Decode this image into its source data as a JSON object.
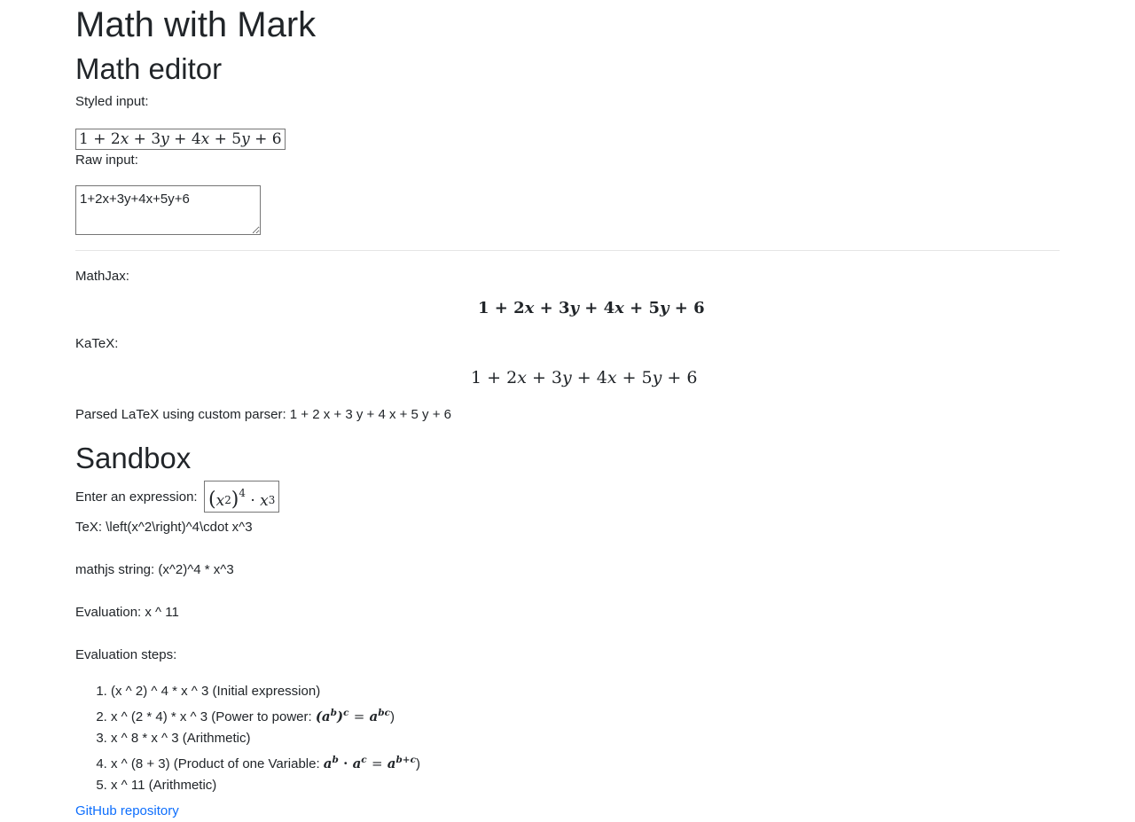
{
  "page": {
    "title": "Math with Mark"
  },
  "editor": {
    "heading": "Math editor",
    "styled_label": "Styled input:",
    "raw_label": "Raw input:",
    "raw_value": "1+2x+3y+4x+5y+6",
    "mathjax_label": "MathJax:",
    "katex_label": "KaTeX:",
    "parsed_label": "Parsed LaTeX using custom parser:",
    "parsed_value": "1 + 2 x + 3 y + 4 x + 5 y + 6"
  },
  "sandbox": {
    "heading": "Sandbox",
    "enter_label": "Enter an expression:",
    "tex_label": "TeX:",
    "tex_value": "\\left(x^2\\right)^4\\cdot x^3",
    "mathjs_label": "mathjs string:",
    "mathjs_value": "(x^2)^4 * x^3",
    "evaluation_label": "Evaluation:",
    "evaluation_value": "x ^ 11",
    "steps_label": "Evaluation steps:",
    "steps": [
      "(x ^ 2) ^ 4 * x ^ 3 (Initial expression)",
      "x ^ (2 * 4) * x ^ 3 (Power to power: ",
      "x ^ 8 * x ^ 3 (Arithmetic)",
      "x ^ (8 + 3) (Product of one Variable: ",
      "x ^ 11 (Arithmetic)"
    ],
    "step_close": ")"
  },
  "footer": {
    "github_link": "GitHub repository"
  }
}
